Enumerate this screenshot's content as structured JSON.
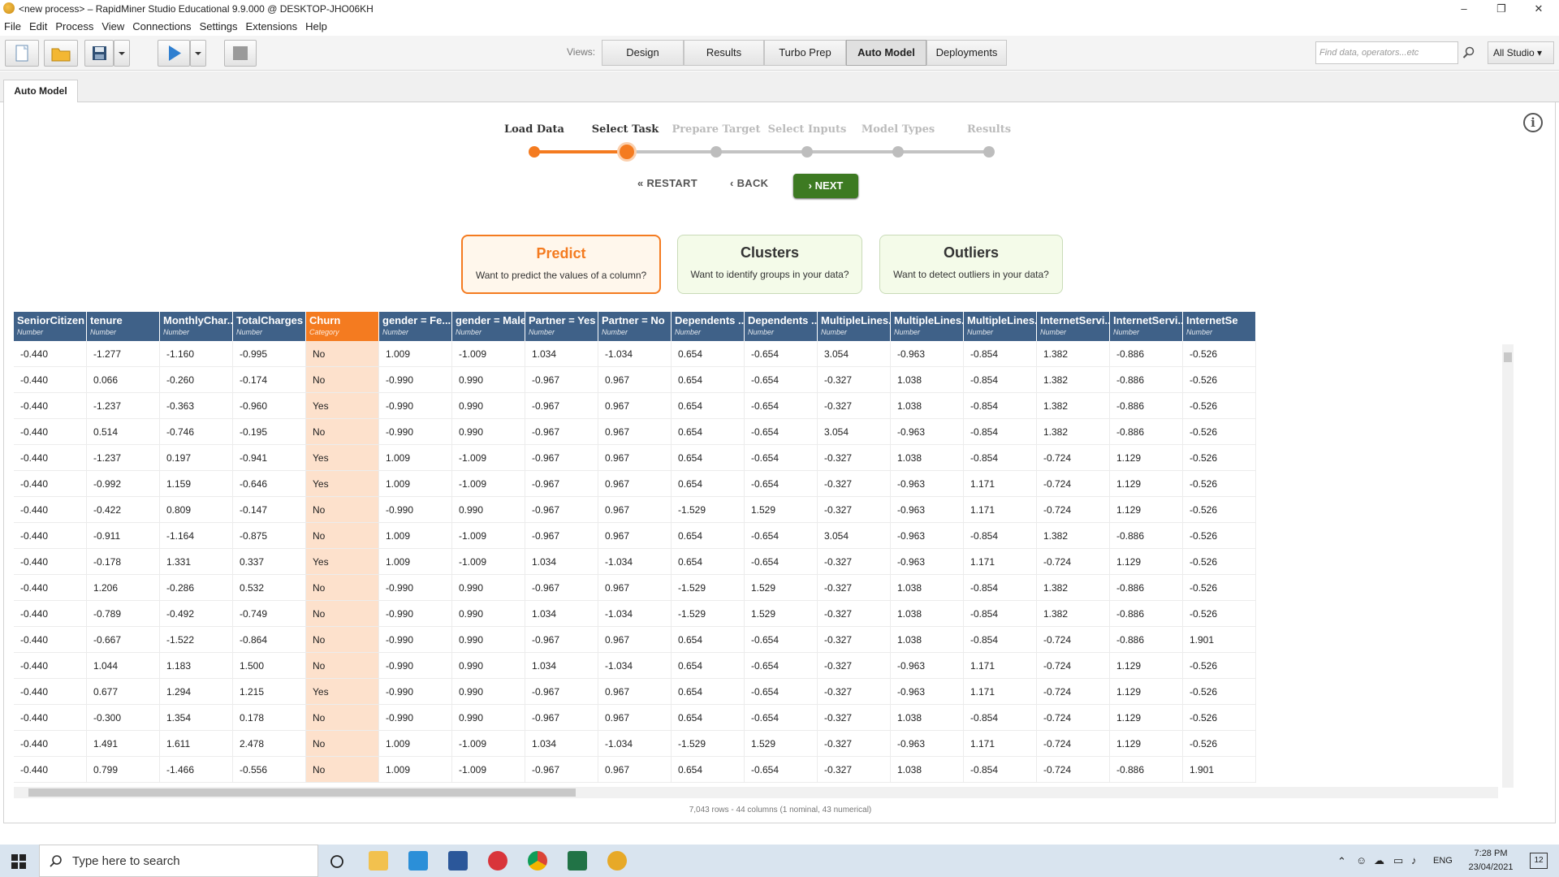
{
  "window": {
    "title": "<new process> – RapidMiner Studio Educational 9.9.000 @ DESKTOP-JHO06KH",
    "minimize": "–",
    "maximize": "❐",
    "close": "✕"
  },
  "menu": [
    "File",
    "Edit",
    "Process",
    "View",
    "Connections",
    "Settings",
    "Extensions",
    "Help"
  ],
  "toolbar": {
    "views_label": "Views:",
    "views": [
      "Design",
      "Results",
      "Turbo Prep",
      "Auto Model",
      "Deployments"
    ],
    "active_view": "Auto Model",
    "search_placeholder": "Find data, operators...etc",
    "studio_dropdown": "All Studio ▾"
  },
  "tab": {
    "label": "Auto Model"
  },
  "wizard": {
    "steps": [
      "Load Data",
      "Select Task",
      "Prepare Target",
      "Select Inputs",
      "Model Types",
      "Results"
    ],
    "restart_label": "RESTART",
    "back_label": "BACK",
    "next_label": "NEXT",
    "cards": [
      {
        "title": "Predict",
        "subtitle": "Want to predict the values of a column?"
      },
      {
        "title": "Clusters",
        "subtitle": "Want to identify groups in your data?"
      },
      {
        "title": "Outliers",
        "subtitle": "Want to detect outliers in your data?"
      }
    ]
  },
  "table": {
    "columns": [
      {
        "name": "SeniorCitizen",
        "type": "Number"
      },
      {
        "name": "tenure",
        "type": "Number"
      },
      {
        "name": "MonthlyChar...",
        "type": "Number"
      },
      {
        "name": "TotalCharges",
        "type": "Number"
      },
      {
        "name": "Churn",
        "type": "Category"
      },
      {
        "name": "gender = Fe...",
        "type": "Number"
      },
      {
        "name": "gender = Male",
        "type": "Number"
      },
      {
        "name": "Partner = Yes",
        "type": "Number"
      },
      {
        "name": "Partner = No",
        "type": "Number"
      },
      {
        "name": "Dependents ...",
        "type": "Number"
      },
      {
        "name": "Dependents ...",
        "type": "Number"
      },
      {
        "name": "MultipleLines...",
        "type": "Number"
      },
      {
        "name": "MultipleLines...",
        "type": "Number"
      },
      {
        "name": "MultipleLines...",
        "type": "Number"
      },
      {
        "name": "InternetServi...",
        "type": "Number"
      },
      {
        "name": "InternetServi...",
        "type": "Number"
      },
      {
        "name": "InternetSe",
        "type": "Number"
      }
    ],
    "rows": [
      [
        "-0.440",
        "-1.277",
        "-1.160",
        "-0.995",
        "No",
        "1.009",
        "-1.009",
        "1.034",
        "-1.034",
        "0.654",
        "-0.654",
        "3.054",
        "-0.963",
        "-0.854",
        "1.382",
        "-0.886",
        "-0.526"
      ],
      [
        "-0.440",
        "0.066",
        "-0.260",
        "-0.174",
        "No",
        "-0.990",
        "0.990",
        "-0.967",
        "0.967",
        "0.654",
        "-0.654",
        "-0.327",
        "1.038",
        "-0.854",
        "1.382",
        "-0.886",
        "-0.526"
      ],
      [
        "-0.440",
        "-1.237",
        "-0.363",
        "-0.960",
        "Yes",
        "-0.990",
        "0.990",
        "-0.967",
        "0.967",
        "0.654",
        "-0.654",
        "-0.327",
        "1.038",
        "-0.854",
        "1.382",
        "-0.886",
        "-0.526"
      ],
      [
        "-0.440",
        "0.514",
        "-0.746",
        "-0.195",
        "No",
        "-0.990",
        "0.990",
        "-0.967",
        "0.967",
        "0.654",
        "-0.654",
        "3.054",
        "-0.963",
        "-0.854",
        "1.382",
        "-0.886",
        "-0.526"
      ],
      [
        "-0.440",
        "-1.237",
        "0.197",
        "-0.941",
        "Yes",
        "1.009",
        "-1.009",
        "-0.967",
        "0.967",
        "0.654",
        "-0.654",
        "-0.327",
        "1.038",
        "-0.854",
        "-0.724",
        "1.129",
        "-0.526"
      ],
      [
        "-0.440",
        "-0.992",
        "1.159",
        "-0.646",
        "Yes",
        "1.009",
        "-1.009",
        "-0.967",
        "0.967",
        "0.654",
        "-0.654",
        "-0.327",
        "-0.963",
        "1.171",
        "-0.724",
        "1.129",
        "-0.526"
      ],
      [
        "-0.440",
        "-0.422",
        "0.809",
        "-0.147",
        "No",
        "-0.990",
        "0.990",
        "-0.967",
        "0.967",
        "-1.529",
        "1.529",
        "-0.327",
        "-0.963",
        "1.171",
        "-0.724",
        "1.129",
        "-0.526"
      ],
      [
        "-0.440",
        "-0.911",
        "-1.164",
        "-0.875",
        "No",
        "1.009",
        "-1.009",
        "-0.967",
        "0.967",
        "0.654",
        "-0.654",
        "3.054",
        "-0.963",
        "-0.854",
        "1.382",
        "-0.886",
        "-0.526"
      ],
      [
        "-0.440",
        "-0.178",
        "1.331",
        "0.337",
        "Yes",
        "1.009",
        "-1.009",
        "1.034",
        "-1.034",
        "0.654",
        "-0.654",
        "-0.327",
        "-0.963",
        "1.171",
        "-0.724",
        "1.129",
        "-0.526"
      ],
      [
        "-0.440",
        "1.206",
        "-0.286",
        "0.532",
        "No",
        "-0.990",
        "0.990",
        "-0.967",
        "0.967",
        "-1.529",
        "1.529",
        "-0.327",
        "1.038",
        "-0.854",
        "1.382",
        "-0.886",
        "-0.526"
      ],
      [
        "-0.440",
        "-0.789",
        "-0.492",
        "-0.749",
        "No",
        "-0.990",
        "0.990",
        "1.034",
        "-1.034",
        "-1.529",
        "1.529",
        "-0.327",
        "1.038",
        "-0.854",
        "1.382",
        "-0.886",
        "-0.526"
      ],
      [
        "-0.440",
        "-0.667",
        "-1.522",
        "-0.864",
        "No",
        "-0.990",
        "0.990",
        "-0.967",
        "0.967",
        "0.654",
        "-0.654",
        "-0.327",
        "1.038",
        "-0.854",
        "-0.724",
        "-0.886",
        "1.901"
      ],
      [
        "-0.440",
        "1.044",
        "1.183",
        "1.500",
        "No",
        "-0.990",
        "0.990",
        "1.034",
        "-1.034",
        "0.654",
        "-0.654",
        "-0.327",
        "-0.963",
        "1.171",
        "-0.724",
        "1.129",
        "-0.526"
      ],
      [
        "-0.440",
        "0.677",
        "1.294",
        "1.215",
        "Yes",
        "-0.990",
        "0.990",
        "-0.967",
        "0.967",
        "0.654",
        "-0.654",
        "-0.327",
        "-0.963",
        "1.171",
        "-0.724",
        "1.129",
        "-0.526"
      ],
      [
        "-0.440",
        "-0.300",
        "1.354",
        "0.178",
        "No",
        "-0.990",
        "0.990",
        "-0.967",
        "0.967",
        "0.654",
        "-0.654",
        "-0.327",
        "1.038",
        "-0.854",
        "-0.724",
        "1.129",
        "-0.526"
      ],
      [
        "-0.440",
        "1.491",
        "1.611",
        "2.478",
        "No",
        "1.009",
        "-1.009",
        "1.034",
        "-1.034",
        "-1.529",
        "1.529",
        "-0.327",
        "-0.963",
        "1.171",
        "-0.724",
        "1.129",
        "-0.526"
      ],
      [
        "-0.440",
        "0.799",
        "-1.466",
        "-0.556",
        "No",
        "1.009",
        "-1.009",
        "-0.967",
        "0.967",
        "0.654",
        "-0.654",
        "-0.327",
        "1.038",
        "-0.854",
        "-0.724",
        "-0.886",
        "1.901"
      ]
    ],
    "status": "7,043 rows - 44 columns (1 nominal, 43 numerical)"
  },
  "taskbar": {
    "search_placeholder": "Type here to search",
    "language": "ENG",
    "time": "7:28 PM",
    "date": "23/04/2021",
    "notifications": "12"
  }
}
